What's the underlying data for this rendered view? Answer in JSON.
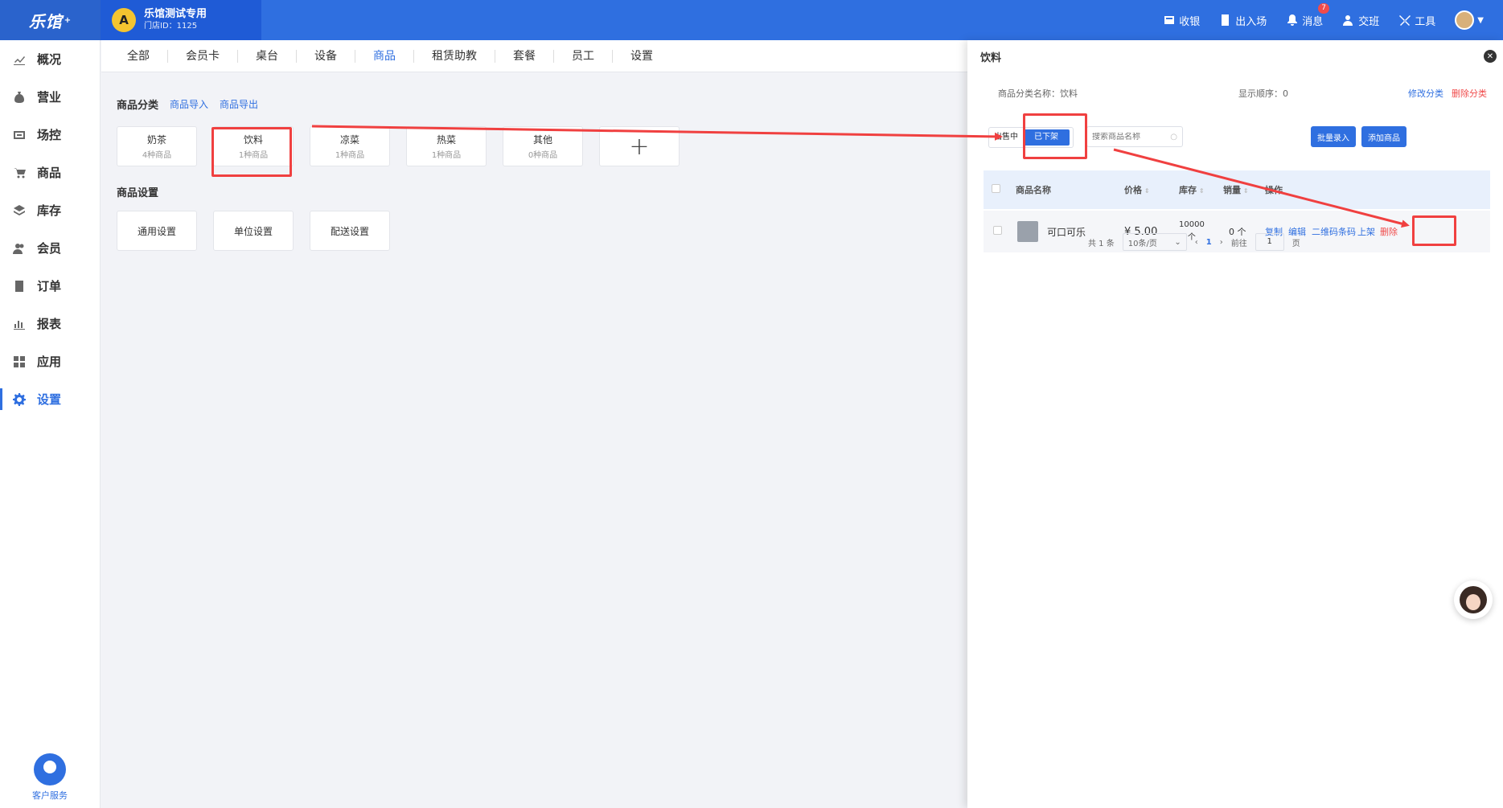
{
  "app": {
    "logo": "乐馆",
    "logo_sup": "+"
  },
  "store": {
    "avatar_letter": "A",
    "name": "乐馆测试专用",
    "id_label": "门店ID：1125"
  },
  "top_actions": [
    {
      "label": "收银",
      "icon": "cashier-icon"
    },
    {
      "label": "出入场",
      "icon": "door-icon"
    },
    {
      "label": "消息",
      "icon": "bell-icon",
      "badge": "7"
    },
    {
      "label": "交班",
      "icon": "handover-icon"
    },
    {
      "label": "工具",
      "icon": "tools-icon"
    }
  ],
  "sidebar": {
    "items": [
      {
        "label": "概况",
        "icon": "chart-icon"
      },
      {
        "label": "营业",
        "icon": "moneybag-icon"
      },
      {
        "label": "场控",
        "icon": "venue-icon"
      },
      {
        "label": "商品",
        "icon": "cart-icon"
      },
      {
        "label": "库存",
        "icon": "layers-icon"
      },
      {
        "label": "会员",
        "icon": "members-icon"
      },
      {
        "label": "订单",
        "icon": "order-icon"
      },
      {
        "label": "报表",
        "icon": "report-icon"
      },
      {
        "label": "应用",
        "icon": "apps-icon"
      },
      {
        "label": "设置",
        "icon": "gear-icon",
        "active": true
      }
    ],
    "service_label": "客户服务"
  },
  "tabs": [
    "全部",
    "会员卡",
    "桌台",
    "设备",
    "商品",
    "租赁助教",
    "套餐",
    "员工",
    "设置"
  ],
  "active_tab": "商品",
  "category_section": {
    "title": "商品分类",
    "import_link": "商品导入",
    "export_link": "商品导出"
  },
  "categories": [
    {
      "name": "奶茶",
      "count": "4种商品"
    },
    {
      "name": "饮料",
      "count": "1种商品"
    },
    {
      "name": "凉菜",
      "count": "1种商品"
    },
    {
      "name": "热菜",
      "count": "1种商品"
    },
    {
      "name": "其他",
      "count": "0种商品"
    }
  ],
  "add_symbol": "+",
  "settings_section": {
    "title": "商品设置",
    "items": [
      "通用设置",
      "单位设置",
      "配送设置"
    ]
  },
  "panel": {
    "title": "饮料",
    "close_symbol": "✕",
    "category_name_label": "商品分类名称：饮料",
    "sort_label": "显示顺序：0",
    "edit_link": "修改分类",
    "delete_link": "删除分类",
    "status_on_sale": "出售中",
    "status_off_shelf": "已下架",
    "search_placeholder": "搜索商品名称",
    "batch_button": "批量录入",
    "add_button": "添加商品",
    "table": {
      "headers": [
        "商品名称",
        "价格",
        "库存",
        "销量",
        "操作"
      ],
      "rows": [
        {
          "name": "可口可乐",
          "price": "¥ 5.00",
          "stock": "10000",
          "stock_unit": "个",
          "sales": "0 个",
          "ops": [
            "复制",
            "编辑",
            "二维码条码",
            "上架",
            "删除"
          ]
        }
      ]
    },
    "pager": {
      "total": "共 1 条",
      "page_size": "10条/页",
      "current": "1",
      "goto_label": "前往",
      "goto_value": "1",
      "page_label": "页"
    }
  },
  "colors": {
    "primary": "#2f6fe0",
    "danger": "#f04b4b",
    "annotation": "#f04040"
  }
}
